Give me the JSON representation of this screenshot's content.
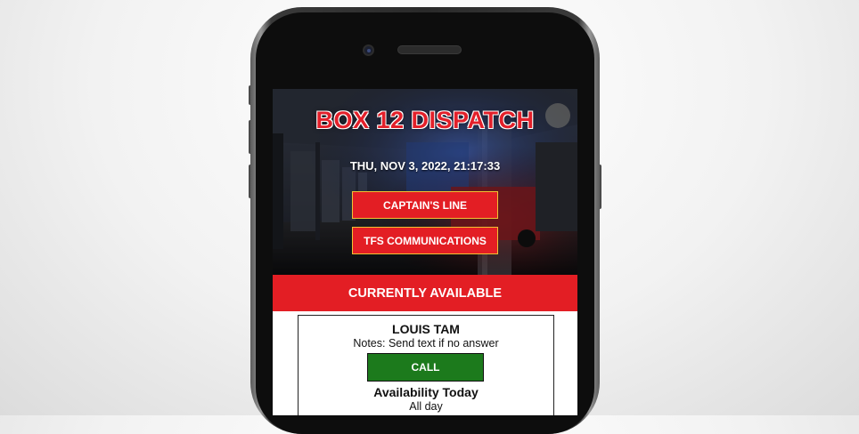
{
  "header": {
    "title": "BOX 12 DISPATCH",
    "datetime": "THU, NOV 3, 2022, 21:17:33"
  },
  "buttons": {
    "captains_line": "CAPTAIN'S LINE",
    "tfs_communications": "TFS COMMUNICATIONS"
  },
  "available": {
    "heading": "CURRENTLY AVAILABLE",
    "person": {
      "name": "LOUIS TAM",
      "notes": "Notes: Send text if no answer",
      "call_label": "CALL",
      "availability_title": "Availability Today",
      "availability_value": "All day"
    }
  },
  "colors": {
    "brand_red": "#e31e24",
    "call_green": "#1c7a1c",
    "button_border": "#f1c232"
  }
}
